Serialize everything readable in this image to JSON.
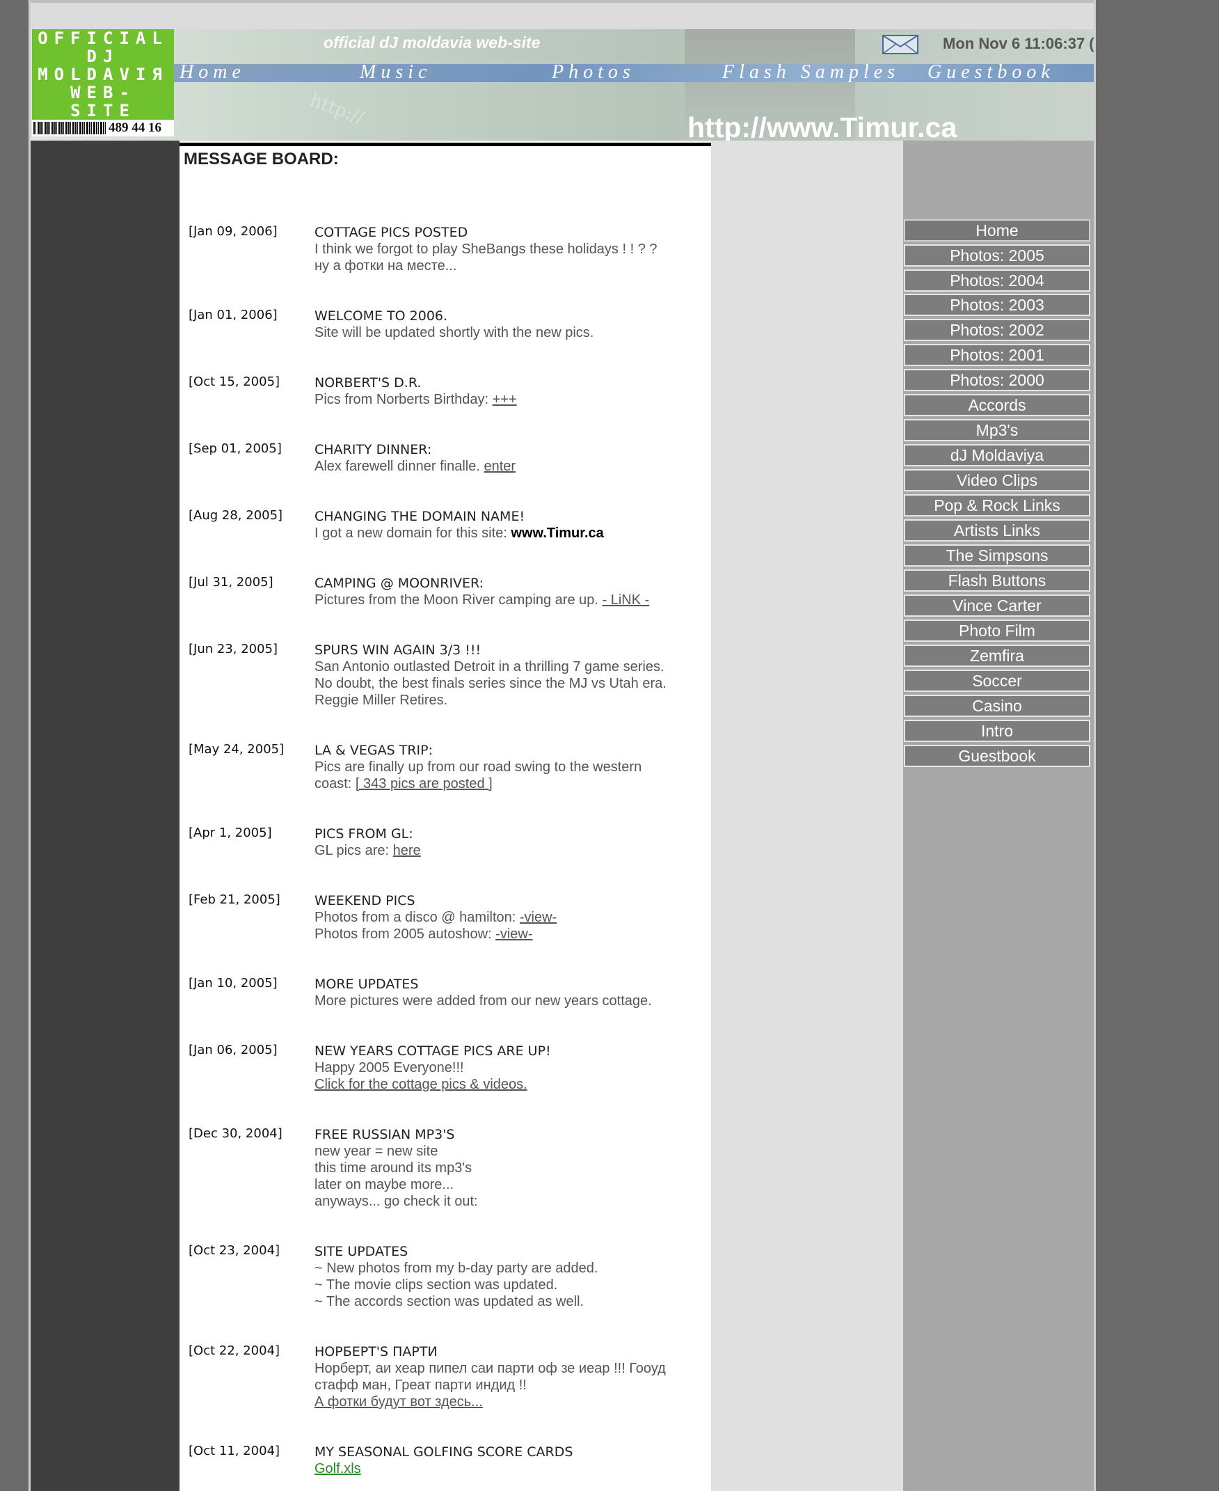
{
  "header": {
    "logo_lines": [
      "OFFICIAL",
      "DJ",
      "MOLDAVIЯ",
      "WEB-",
      "SITE"
    ],
    "logo_number": "489 44 16",
    "tagline": "official dJ moldavia web-site",
    "clock": "Mon Nov 6 11:06:37 (",
    "url": "http://www.Timur.ca",
    "watermark": "http://",
    "nav": [
      "Home",
      "Music",
      "Photos",
      "Flash Samples",
      "Guestbook"
    ]
  },
  "board": {
    "title": "MESSAGE BOARD:",
    "entries": [
      {
        "date": "[Jan 09, 2006]",
        "title": "COTTAGE PICS POSTED",
        "lines": [
          "I think we forgot to play SheBangs these holidays ! ! ? ?",
          "ну а фотки на месте..."
        ]
      },
      {
        "date": "[Jan 01, 2006]",
        "title": "WELCOME TO 2006.",
        "lines": [
          "Site will be updated shortly with the new pics."
        ]
      },
      {
        "date": "[Oct 15, 2005]",
        "title": "NORBERT'S D.R.",
        "lines": [
          "Pics from Norberts Birthday: "
        ],
        "link": "+++"
      },
      {
        "date": "[Sep 01, 2005]",
        "title": "CHARITY DINNER:",
        "lines": [
          "Alex farewell dinner finalle. "
        ],
        "link": "enter"
      },
      {
        "date": "[Aug 28, 2005]",
        "title": "CHANGING THE DOMAIN NAME!",
        "lines": [
          "I got a new domain for this site: "
        ],
        "strong": "www.Timur.ca"
      },
      {
        "date": "[Jul 31, 2005]",
        "title": "CAMPING @ MOONRIVER:",
        "lines": [
          "Pictures from the Moon River camping are up. "
        ],
        "link": "- LiNK -"
      },
      {
        "date": "[Jun 23, 2005]",
        "title": "SPURS WIN AGAIN 3/3 !!!",
        "lines": [
          "San Antonio outlasted Detroit in a thrilling 7 game series.",
          "No doubt, the best finals series since the MJ vs Utah era.",
          "Reggie Miller Retires."
        ]
      },
      {
        "date": "[May 24, 2005]",
        "title": "LA & VEGAS TRIP:",
        "lines": [
          "Pics are finally up from our road swing to the western",
          "coast: "
        ],
        "link": "[ 343 pics are posted ]"
      },
      {
        "date": "[Apr 1, 2005]",
        "title": "PICS FROM GL:",
        "lines": [
          "GL pics are: "
        ],
        "link": "here"
      },
      {
        "date": "[Feb 21, 2005]",
        "title": "WEEKEND PICS",
        "lines": [
          "Photos from a disco @ hamilton: ",
          "Photos from 2005 autoshow: "
        ],
        "links": [
          " -view-",
          " -view-"
        ]
      },
      {
        "date": "[Jan 10, 2005]",
        "title": "MORE UPDATES",
        "lines": [
          "More pictures were added from our new years cottage."
        ]
      },
      {
        "date": "[Jan 06, 2005]",
        "title": "NEW YEARS COTTAGE PICS ARE UP!",
        "lines": [
          "Happy 2005 Everyone!!!"
        ],
        "link_line": "Click for the cottage pics & videos."
      },
      {
        "date": "[Dec 30, 2004]",
        "title": "FREE RUSSIAN MP3'S",
        "lines": [
          "new year = new site",
          "this time around its mp3's",
          "later on maybe more...",
          "anyways... go check it out:"
        ]
      },
      {
        "date": "[Oct 23, 2004]",
        "title": "SITE UPDATES",
        "lines": [
          "~ New photos from my b-day party are added.",
          "~ The movie clips section was updated.",
          "~ The accords section was updated as well."
        ]
      },
      {
        "date": "[Oct 22, 2004]",
        "title": "НОРБЕРТ'S ПАРТИ",
        "lines": [
          "Норберт, аи хеар пипел саи парти оф зе иеар !!! Гооуд",
          "стафф ман, Греат парти индид !!"
        ],
        "link_line": "А фотки будут вот здесь..."
      },
      {
        "date": "[Oct 11, 2004]",
        "title": "MY SEASONAL GOLFING SCORE CARDS",
        "lines": [],
        "green_link": "Golf.xls"
      }
    ]
  },
  "sidebar": {
    "items": [
      "Home",
      "Photos: 2005",
      "Photos: 2004",
      "Photos: 2003",
      "Photos: 2002",
      "Photos: 2001",
      "Photos: 2000",
      "Accords",
      "Mp3's",
      "dJ Moldaviya",
      "Video Clips",
      "Pop & Rock Links",
      "Artists Links",
      "The Simpsons",
      "Flash Buttons",
      "Vince Carter",
      "Photo Film",
      "Zemfira",
      "Soccer",
      "Casino",
      "Intro",
      "Guestbook"
    ]
  }
}
